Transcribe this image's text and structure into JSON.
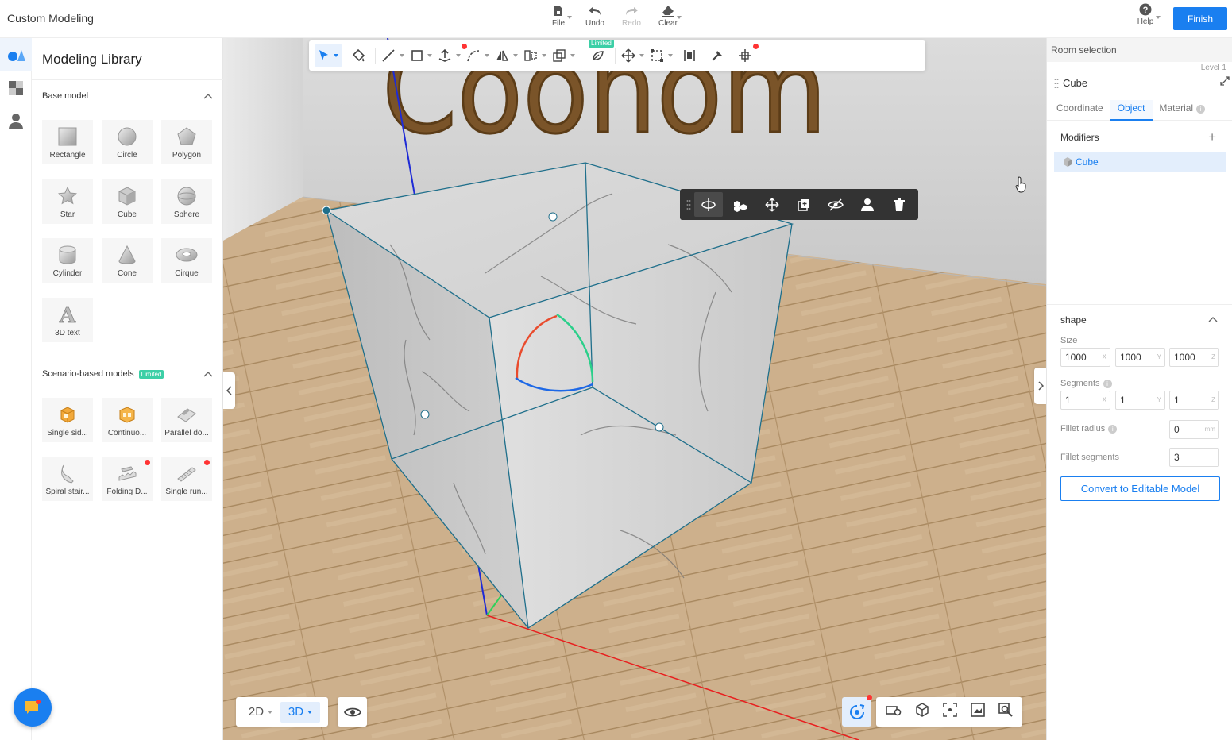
{
  "app": {
    "title": "Custom Modeling"
  },
  "top_actions": [
    {
      "label": "File",
      "icon": "file-icon",
      "caret": true,
      "disabled": false
    },
    {
      "label": "Undo",
      "icon": "undo-icon",
      "caret": false,
      "disabled": false
    },
    {
      "label": "Redo",
      "icon": "redo-icon",
      "caret": false,
      "disabled": true
    },
    {
      "label": "Clear",
      "icon": "clear-icon",
      "caret": true,
      "disabled": false
    }
  ],
  "help": {
    "label": "Help"
  },
  "finish": {
    "label": "Finish"
  },
  "library": {
    "title": "Modeling Library",
    "base_section": "Base model",
    "base_items": [
      {
        "label": "Rectangle",
        "icon": "rectangle-icon"
      },
      {
        "label": "Circle",
        "icon": "circle-icon"
      },
      {
        "label": "Polygon",
        "icon": "polygon-icon"
      },
      {
        "label": "Star",
        "icon": "star-icon"
      },
      {
        "label": "Cube",
        "icon": "cube-icon"
      },
      {
        "label": "Sphere",
        "icon": "sphere-icon"
      },
      {
        "label": "Cylinder",
        "icon": "cylinder-icon"
      },
      {
        "label": "Cone",
        "icon": "cone-icon"
      },
      {
        "label": "Cirque",
        "icon": "cirque-icon"
      },
      {
        "label": "3D text",
        "icon": "3d-text-icon"
      }
    ],
    "scenario_section": "Scenario-based models",
    "scenario_badge": "Limited",
    "scenario_items": [
      {
        "label": "Single sid...",
        "icon": "single-side-icon",
        "dot": false
      },
      {
        "label": "Continuo...",
        "icon": "continuous-icon",
        "dot": false
      },
      {
        "label": "Parallel do...",
        "icon": "parallel-door-icon",
        "dot": false
      },
      {
        "label": "Spiral stair...",
        "icon": "spiral-stair-icon",
        "dot": false
      },
      {
        "label": "Folding D...",
        "icon": "folding-door-icon",
        "dot": true
      },
      {
        "label": "Single run...",
        "icon": "single-run-icon",
        "dot": true
      }
    ]
  },
  "viewport": {
    "toolbar_badge": "Limited",
    "view_modes": [
      "2D",
      "3D"
    ],
    "active_view": "3D",
    "scene_text": "Coonom"
  },
  "right_panel": {
    "room_selection": "Room selection",
    "level": "Level 1",
    "object_name": "Cube",
    "tabs": [
      "Coordinate",
      "Object",
      "Material"
    ],
    "active_tab": "Object",
    "modifiers_title": "Modifiers",
    "modifier_item": "Cube",
    "shape_title": "shape",
    "size_label": "Size",
    "size": [
      {
        "value": "1000",
        "axis": "X"
      },
      {
        "value": "1000",
        "axis": "Y"
      },
      {
        "value": "1000",
        "axis": "Z"
      }
    ],
    "segments_label": "Segments",
    "segments": [
      {
        "value": "1",
        "axis": "X"
      },
      {
        "value": "1",
        "axis": "Y"
      },
      {
        "value": "1",
        "axis": "Z"
      }
    ],
    "fillet_radius_label": "Fillet radius",
    "fillet_radius": {
      "value": "0",
      "unit": "mm"
    },
    "fillet_segments_label": "Fillet segments",
    "fillet_segments": "3",
    "convert_label": "Convert to Editable Model"
  },
  "colors": {
    "accent": "#1a7ff0",
    "limited": "#3ccfa6",
    "notify": "#ff3333",
    "cube_edge": "#1f6f8b",
    "floor": "#c9ad8a"
  }
}
